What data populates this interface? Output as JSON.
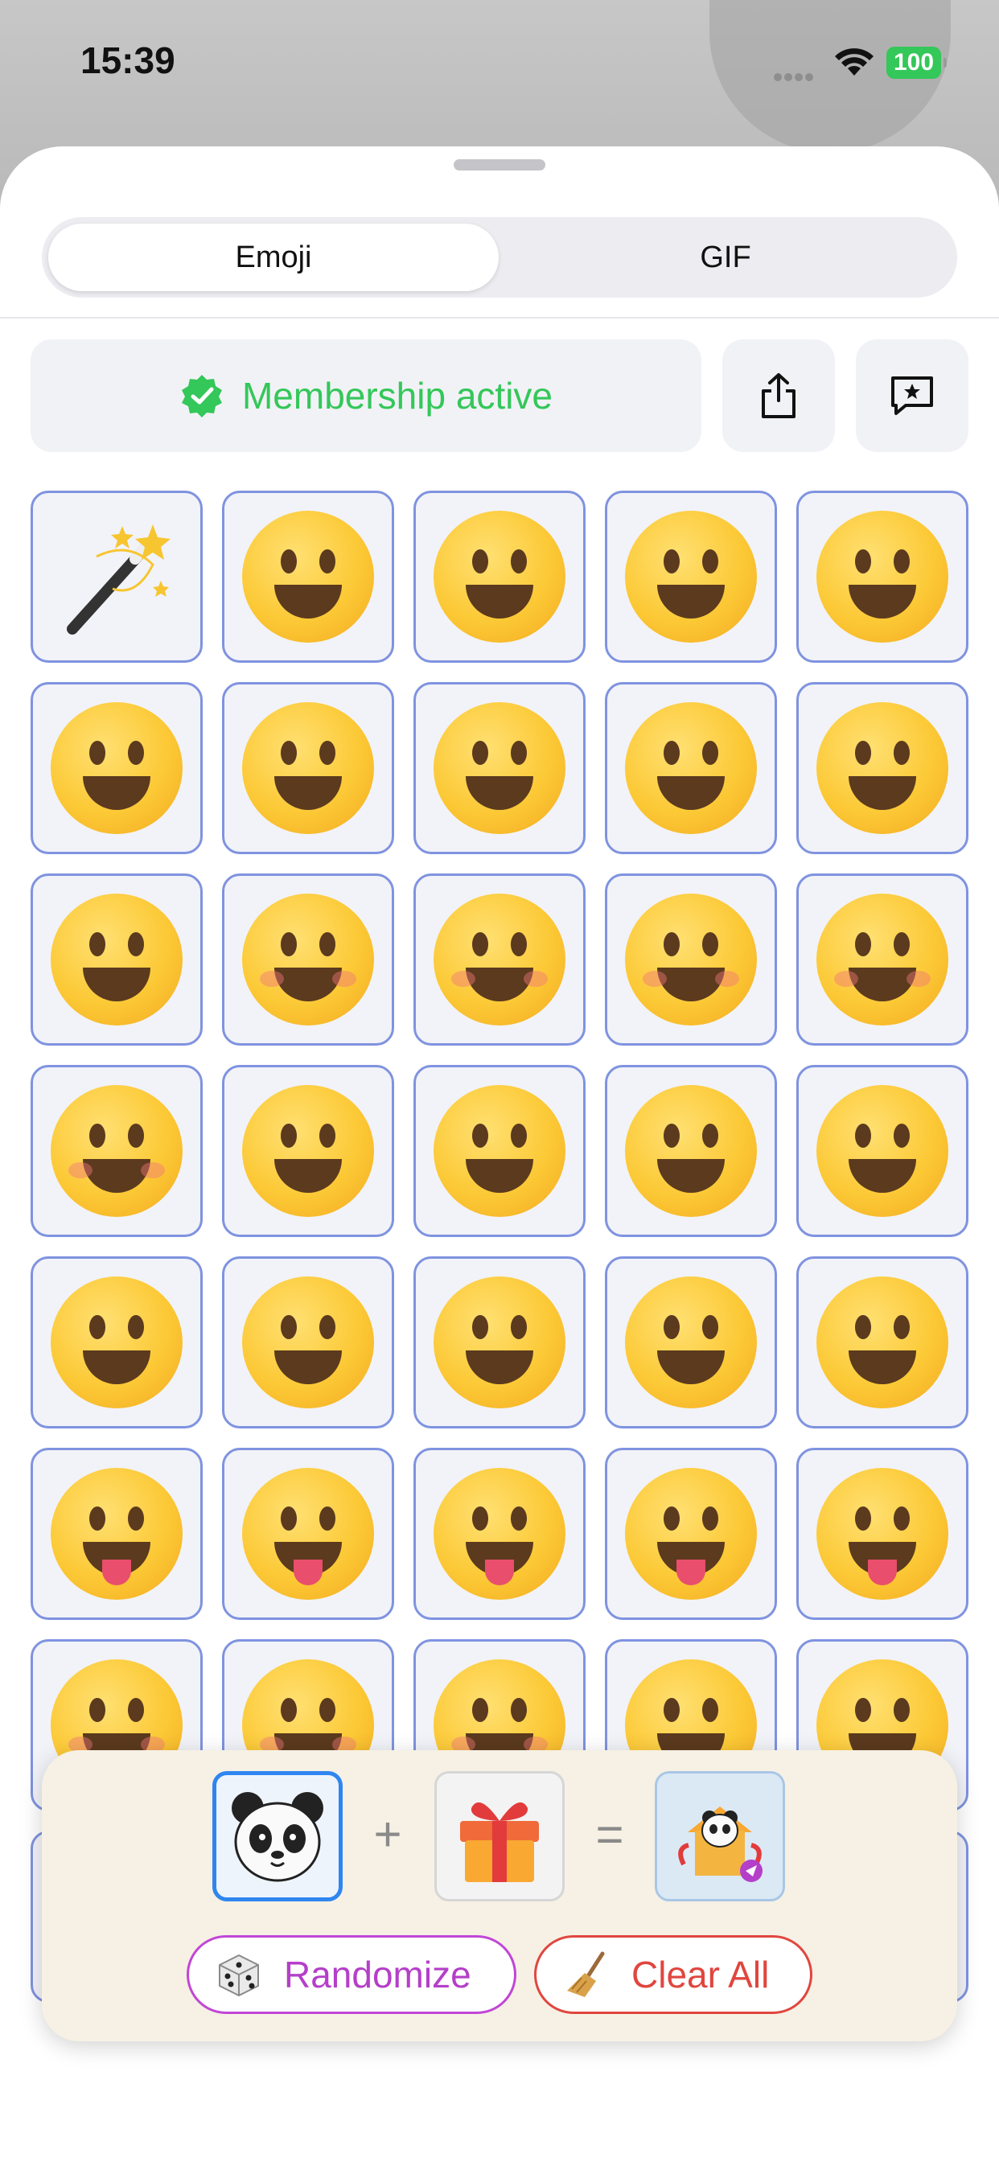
{
  "status_bar": {
    "time": "15:39",
    "battery": "100"
  },
  "tabs": {
    "emoji_label": "Emoji",
    "gif_label": "GIF",
    "selected": "Emoji"
  },
  "membership": {
    "label": "Membership active",
    "accent_color": "#34c759"
  },
  "toolbar": {
    "share_icon": "share-icon",
    "feedback_icon": "message-star-icon"
  },
  "emoji_grid": {
    "items": [
      "magic-wand",
      "grinning-face",
      "grinning-big-eyes",
      "grinning-smiling-eyes",
      "beaming-face",
      "squinting-laughing",
      "grinning-sweat",
      "tears-of-joy",
      "rolling-laughing",
      "loudly-crying",
      "winking-face",
      "kissing-face",
      "kissing-smiling-eyes",
      "kissing-closed-eyes",
      "face-blowing-kiss",
      "smiling-hearts",
      "heart-eyes",
      "star-struck",
      "partying-face",
      "relieved-shine",
      "face-exhaling",
      "upside-down",
      "slightly-smiling",
      "smiling-tear",
      "pleading-face",
      "savoring-food",
      "tongue-out",
      "squinting-tongue",
      "winking-tongue",
      "zany-face",
      "halo-face",
      "smiling-blush",
      "smiling-cheeks",
      "smirking-face",
      "relieved-face",
      "thinking-face",
      "shushing-face",
      "hand-over-mouth",
      "hand-over-smile",
      "yawning-face"
    ]
  },
  "mixer": {
    "slot_left": "panda-icon",
    "slot_right": "gift-icon",
    "result": "panda-gift-result-icon",
    "plus": "+",
    "equals": "=",
    "randomize_label": "Randomize",
    "clear_label": "Clear All",
    "randomize_color": "#b43fc9",
    "clear_color": "#e0463f"
  }
}
